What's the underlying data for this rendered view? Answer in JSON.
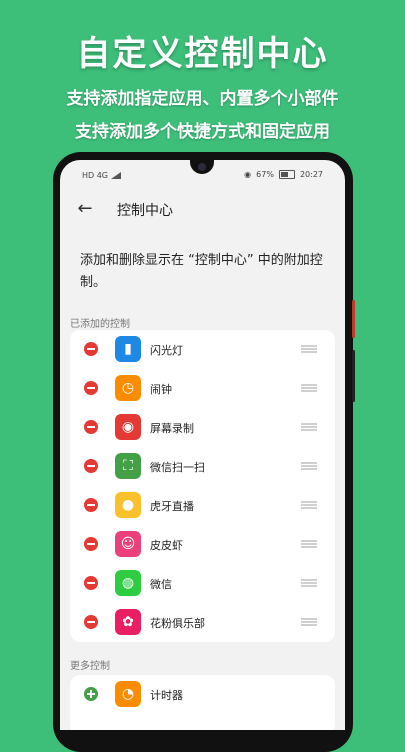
{
  "promo": {
    "title": "自定义控制中心",
    "line1": "支持添加指定应用、内置多个小部件",
    "line2": "支持添加多个快捷方式和固定应用"
  },
  "statusbar": {
    "left": "HD 4G",
    "battery": "67%",
    "time": "20:27"
  },
  "appbar": {
    "title": "控制中心"
  },
  "description": "添加和删除显示在 “控制中心” 中的附加控制。",
  "sections": {
    "added_label": "已添加的控制",
    "more_label": "更多控制"
  },
  "added_items": [
    {
      "label": "闪光灯",
      "icon": "flashlight-icon",
      "color": "#1e88e5"
    },
    {
      "label": "闹钟",
      "icon": "alarm-clock-icon",
      "color": "#fb8c00"
    },
    {
      "label": "屏幕录制",
      "icon": "screen-record-icon",
      "color": "#e53935"
    },
    {
      "label": "微信扫一扫",
      "icon": "wechat-scan-icon",
      "color": "#43a047"
    },
    {
      "label": "虎牙直播",
      "icon": "huya-live-icon",
      "color": "#fbc02d"
    },
    {
      "label": "皮皮虾",
      "icon": "pipixia-icon",
      "color": "#ec407a"
    },
    {
      "label": "微信",
      "icon": "wechat-icon",
      "color": "#2ecc40"
    },
    {
      "label": "花粉俱乐部",
      "icon": "lotus-icon",
      "color": "#e91e63"
    }
  ],
  "more_items": [
    {
      "label": "计时器",
      "icon": "timer-icon",
      "color": "#fb8c00"
    }
  ]
}
